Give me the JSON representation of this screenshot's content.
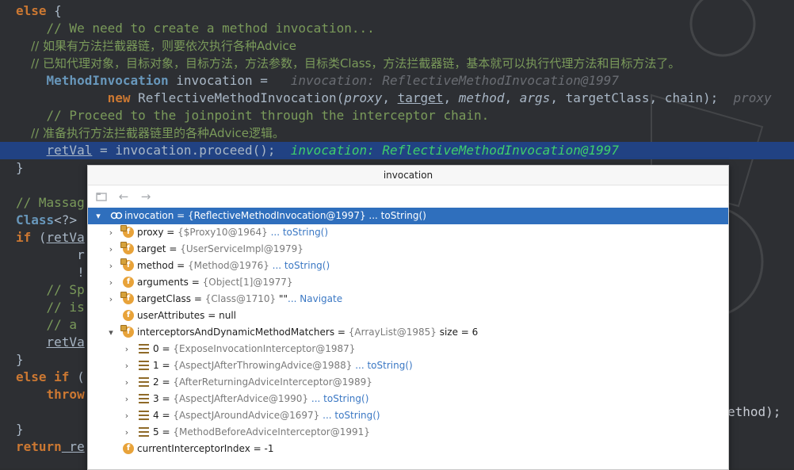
{
  "editor": {
    "lines": [
      {
        "segments": [
          {
            "t": "else",
            "c": "kw"
          },
          {
            "t": " {",
            "c": "var"
          }
        ]
      },
      {
        "segments": [
          {
            "t": "    // We need to create a method invocation...",
            "c": "cm"
          }
        ]
      },
      {
        "segments": [
          {
            "t": "    // 如果有方法拦截器链，则要依次执行各种Advice",
            "c": "cmcn"
          }
        ]
      },
      {
        "segments": [
          {
            "t": "    // 已知代理对象，目标对象，目标方法，方法参数，目标类Class，方法拦截器链，基本就可以执行代理方法和目标方法了。",
            "c": "cmcn"
          }
        ]
      },
      {
        "segments": [
          {
            "t": "    ",
            "c": "var"
          },
          {
            "t": "MethodInvocation",
            "c": "cls"
          },
          {
            "t": " invocation = ",
            "c": "var"
          },
          {
            "t": "  invocation: ReflectiveMethodInvocation@1997",
            "c": "hint"
          }
        ]
      },
      {
        "segments": [
          {
            "t": "            ",
            "c": "var"
          },
          {
            "t": "new",
            "c": "kw"
          },
          {
            "t": " ReflectiveMethodInvocation(",
            "c": "var"
          },
          {
            "t": "proxy",
            "c": "var it"
          },
          {
            "t": ", ",
            "c": "var"
          },
          {
            "t": "target",
            "c": "var ul"
          },
          {
            "t": ", ",
            "c": "var"
          },
          {
            "t": "method",
            "c": "var it"
          },
          {
            "t": ", ",
            "c": "var"
          },
          {
            "t": "args",
            "c": "var it"
          },
          {
            "t": ", targetClass, chain);  ",
            "c": "var"
          },
          {
            "t": "proxy",
            "c": "hint"
          }
        ]
      },
      {
        "segments": [
          {
            "t": "    // Proceed to the joinpoint through the interceptor chain.",
            "c": "cm"
          }
        ]
      },
      {
        "segments": [
          {
            "t": "    // 准备执行方法拦截器链里的各种Advice逻辑。",
            "c": "cmcn"
          }
        ]
      },
      {
        "segments": [
          {
            "t": "    ",
            "c": "var"
          },
          {
            "t": "retVal",
            "c": "var ul"
          },
          {
            "t": " = invocation.proceed();  ",
            "c": "var"
          },
          {
            "t": "invocation: ReflectiveMethodInvocation@1997",
            "c": "hint-g"
          }
        ],
        "highlight": true
      },
      {
        "segments": [
          {
            "t": "}",
            "c": "var"
          }
        ]
      },
      {
        "segments": [
          {
            "t": "",
            "c": "var"
          }
        ]
      },
      {
        "segments": [
          {
            "t": "// Massag",
            "c": "cm"
          }
        ]
      },
      {
        "segments": [
          {
            "t": "Class",
            "c": "cls"
          },
          {
            "t": "<?>",
            "c": "var"
          }
        ]
      },
      {
        "segments": [
          {
            "t": "if",
            "c": "kw"
          },
          {
            "t": " (",
            "c": "var"
          },
          {
            "t": "retVa",
            "c": "var ul"
          }
        ]
      },
      {
        "segments": [
          {
            "t": "        r",
            "c": "var"
          }
        ]
      },
      {
        "segments": [
          {
            "t": "        !",
            "c": "var"
          }
        ]
      },
      {
        "segments": [
          {
            "t": "    // Sp",
            "c": "cm"
          }
        ]
      },
      {
        "segments": [
          {
            "t": "    // is",
            "c": "cm"
          }
        ]
      },
      {
        "segments": [
          {
            "t": "    // a ",
            "c": "cm"
          }
        ]
      },
      {
        "segments": [
          {
            "t": "    ",
            "c": "var"
          },
          {
            "t": "retVa",
            "c": "var ul"
          }
        ]
      },
      {
        "segments": [
          {
            "t": "}",
            "c": "var"
          }
        ]
      },
      {
        "segments": [
          {
            "t": "else if",
            "c": "kw"
          },
          {
            "t": " (",
            "c": "var"
          }
        ]
      },
      {
        "segments": [
          {
            "t": "    ",
            "c": "var"
          },
          {
            "t": "throw",
            "c": "kw"
          }
        ]
      },
      {
        "segments": [
          {
            "t": "",
            "c": "var"
          }
        ]
      },
      {
        "segments": [
          {
            "t": "}",
            "c": "var"
          }
        ]
      },
      {
        "segments": [
          {
            "t": "return",
            "c": "kw"
          },
          {
            "t": " re",
            "c": "var ul"
          }
        ]
      }
    ],
    "right_fragment": "ethod);"
  },
  "popup": {
    "title": "invocation",
    "rows": [
      {
        "level": 0,
        "arrow": "▾",
        "icon": "oo",
        "name": "invocation",
        "value": " = {ReflectiveMethodInvocation@1997} ... toString()",
        "selected": true
      },
      {
        "level": 1,
        "arrow": "›",
        "icon": "field-lock",
        "name": "proxy",
        "eq": " = ",
        "ref": "{$Proxy10@1964}",
        "link": " ... toString()"
      },
      {
        "level": 1,
        "arrow": "›",
        "icon": "field-lock",
        "name": "target",
        "eq": " = ",
        "ref": "{UserServiceImpl@1979}",
        "link": ""
      },
      {
        "level": 1,
        "arrow": "›",
        "icon": "field-lock",
        "name": "method",
        "eq": " = ",
        "ref": "{Method@1976}",
        "link": " ... toString()"
      },
      {
        "level": 1,
        "arrow": "›",
        "icon": "field",
        "name": "arguments",
        "eq": " = ",
        "ref": "{Object[1]@1977}",
        "link": ""
      },
      {
        "level": 1,
        "arrow": "›",
        "icon": "field-lock",
        "name": "targetClass",
        "eq": " = ",
        "ref": "{Class@1710}",
        "extra": " \"\"",
        "link": "... Navigate"
      },
      {
        "level": 1,
        "arrow": "",
        "icon": "field",
        "name": "userAttributes",
        "eq": " = null",
        "ref": "",
        "link": ""
      },
      {
        "level": 1,
        "arrow": "▾",
        "icon": "field-lock",
        "name": "interceptorsAndDynamicMethodMatchers",
        "eq": " = ",
        "ref": "{ArrayList@1985}",
        "extra": "  size = 6",
        "link": ""
      },
      {
        "level": 2,
        "arrow": "›",
        "icon": "list",
        "name": "0",
        "eq": " = ",
        "ref": "{ExposeInvocationInterceptor@1987}",
        "link": ""
      },
      {
        "level": 2,
        "arrow": "›",
        "icon": "list",
        "name": "1",
        "eq": " = ",
        "ref": "{AspectJAfterThrowingAdvice@1988}",
        "link": " ... toString()"
      },
      {
        "level": 2,
        "arrow": "›",
        "icon": "list",
        "name": "2",
        "eq": " = ",
        "ref": "{AfterReturningAdviceInterceptor@1989}",
        "link": ""
      },
      {
        "level": 2,
        "arrow": "›",
        "icon": "list",
        "name": "3",
        "eq": " = ",
        "ref": "{AspectJAfterAdvice@1990}",
        "link": " ... toString()"
      },
      {
        "level": 2,
        "arrow": "›",
        "icon": "list",
        "name": "4",
        "eq": " = ",
        "ref": "{AspectJAroundAdvice@1697}",
        "link": " ... toString()"
      },
      {
        "level": 2,
        "arrow": "›",
        "icon": "list",
        "name": "5",
        "eq": " = ",
        "ref": "{MethodBeforeAdviceInterceptor@1991}",
        "link": ""
      },
      {
        "level": 1,
        "arrow": "",
        "icon": "field",
        "name": "currentInterceptorIndex",
        "eq": " = -1",
        "ref": "",
        "link": ""
      }
    ]
  },
  "colors": {
    "selection": "#2f6fbd",
    "highlight_line": "#214283",
    "comment": "#7a9a5a",
    "keyword": "#cc7832",
    "class": "#6897bb"
  }
}
